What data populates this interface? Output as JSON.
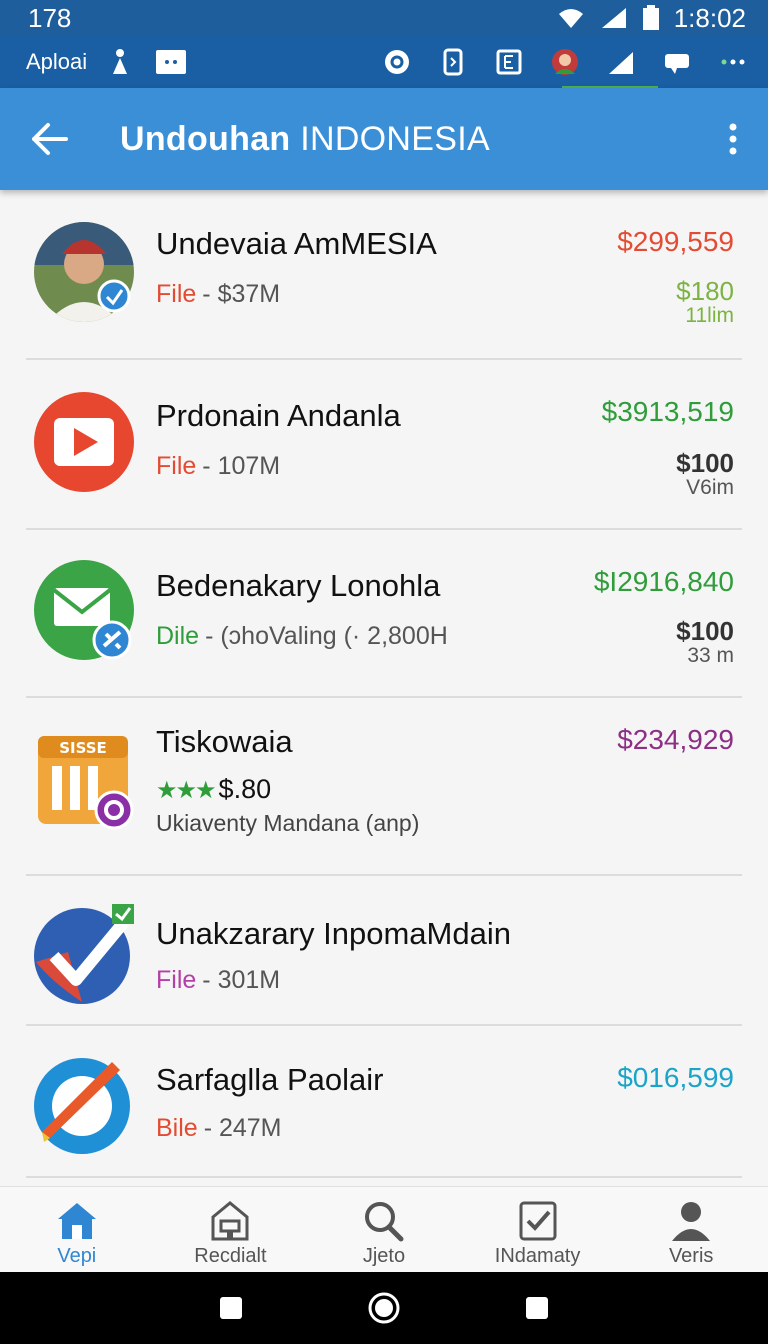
{
  "status": {
    "left": "178",
    "time": "1:8:02"
  },
  "notif": {
    "app_label": "Aploai"
  },
  "header": {
    "title_bold": "Undouhan",
    "title_rest": " INDONESIA"
  },
  "items": [
    {
      "name": "Undevaia AmMESIA",
      "kind": "File",
      "kind_color": "#e34c33",
      "detail": "- $37M",
      "price": "$299,559",
      "price_color": "#e34c33",
      "price2": "$180",
      "price2_color": "#7cb342",
      "price3": "11lim",
      "price3_color": "#7cb342"
    },
    {
      "name": "Prdonain Andanla",
      "kind": "File",
      "kind_color": "#e34c33",
      "detail": "- 107M",
      "price": "$3913,519",
      "price_color": "#2e9d3a",
      "price2": "$100",
      "price2_color": "#333333",
      "price3": "V6im",
      "price3_color": "#555555"
    },
    {
      "name": "Bedenakary Lonohla",
      "kind": "Dile",
      "kind_color": "#2e9d3a",
      "detail": "- (ɔhoValing (· 2,800H",
      "price": "$I2916,840",
      "price_color": "#2e9d3a",
      "price2": "$100",
      "price2_color": "#333333",
      "price3": "33 m",
      "price3_color": "#555555"
    },
    {
      "name": "Tiskowaia",
      "stars": "★★★",
      "rating": "$.80",
      "detail2": "Ukiaventy Mandana (anp)",
      "price": "$234,929",
      "price_color": "#8e2f86"
    },
    {
      "name": "Unakzarary InpomaMdain",
      "kind": "File",
      "kind_color": "#b53fa8",
      "detail": "- 301M"
    },
    {
      "name": "Sarfaglla Paolair",
      "kind": "Bile",
      "kind_color": "#e34c33",
      "detail": "- 247M",
      "price": "$016,599",
      "price_color": "#1ba4c9"
    }
  ],
  "icons": {
    "item1": "avatar-photo",
    "item2": "play-icon",
    "item3": "mail-icon",
    "item4": "app-grid-icon",
    "item5": "checkmark-icon",
    "item6": "compass-icon",
    "item4_badge": "SISSE"
  },
  "bottom_nav": [
    {
      "label": "Vepi",
      "icon": "home-icon"
    },
    {
      "label": "Recdialt",
      "icon": "store-icon"
    },
    {
      "label": "Jjeto",
      "icon": "search-icon"
    },
    {
      "label": "INdamaty",
      "icon": "checkbox-icon"
    },
    {
      "label": "Veris",
      "icon": "person-icon"
    }
  ]
}
